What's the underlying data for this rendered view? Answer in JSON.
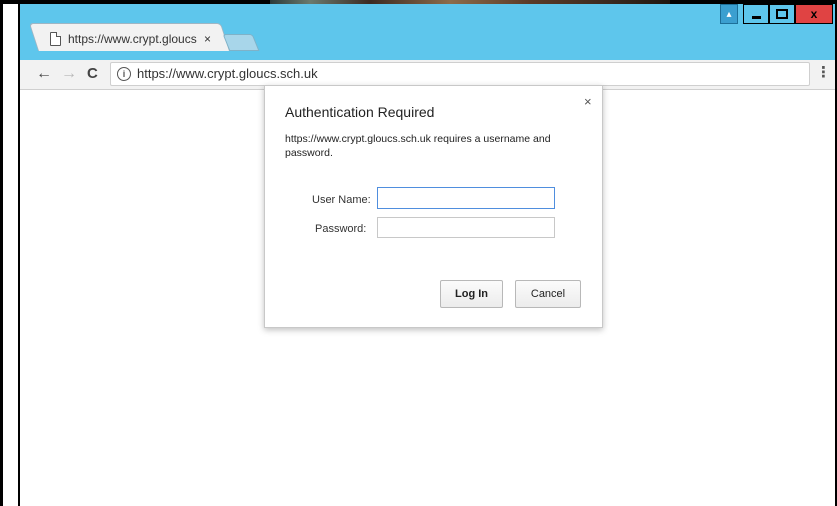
{
  "tab": {
    "title": "https://www.crypt.gloucs",
    "close_icon": "×"
  },
  "window_controls": {
    "user": "▴",
    "close": "x"
  },
  "toolbar": {
    "back_icon": "←",
    "forward_icon": "→",
    "reload_icon": "C",
    "info_icon": "i",
    "url": "https://www.crypt.gloucs.sch.uk",
    "star_icon": "☆",
    "menu_icon": "⋮"
  },
  "dialog": {
    "close_icon": "×",
    "title": "Authentication Required",
    "message": "https://www.crypt.gloucs.sch.uk requires a username and password.",
    "username_label": "User Name:",
    "password_label": "Password:",
    "username_value": "",
    "password_value": "",
    "login_label": "Log In",
    "cancel_label": "Cancel"
  },
  "colors": {
    "titlebar": "#5ec6ec",
    "close_button": "#e04343",
    "focus_border": "#4f8ede"
  }
}
